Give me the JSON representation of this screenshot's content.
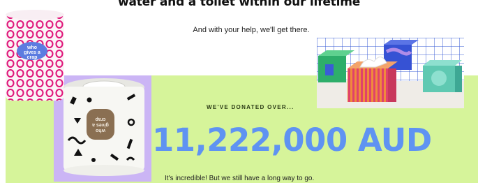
{
  "page": {
    "headline": "water and a toilet within our lifetime",
    "subline": "And with your help, we'll get there.",
    "donated_label": "WE'VE DONATED OVER...",
    "amount": "11,222,000 AUD",
    "incredible": "It's incredible! But we still have a long way to go."
  },
  "images": {
    "roll_one": {
      "label_lines": [
        "who",
        "gives a",
        "crap"
      ]
    },
    "roll_two": {
      "label_lines": [
        "who",
        "gives a",
        "crap"
      ]
    },
    "tissue_boxes": {}
  },
  "colors": {
    "green_band": "#d6f49a",
    "amount": "#5f93f2",
    "purple_block": "#cbb5f5",
    "pink_rings": "#e0177b"
  }
}
